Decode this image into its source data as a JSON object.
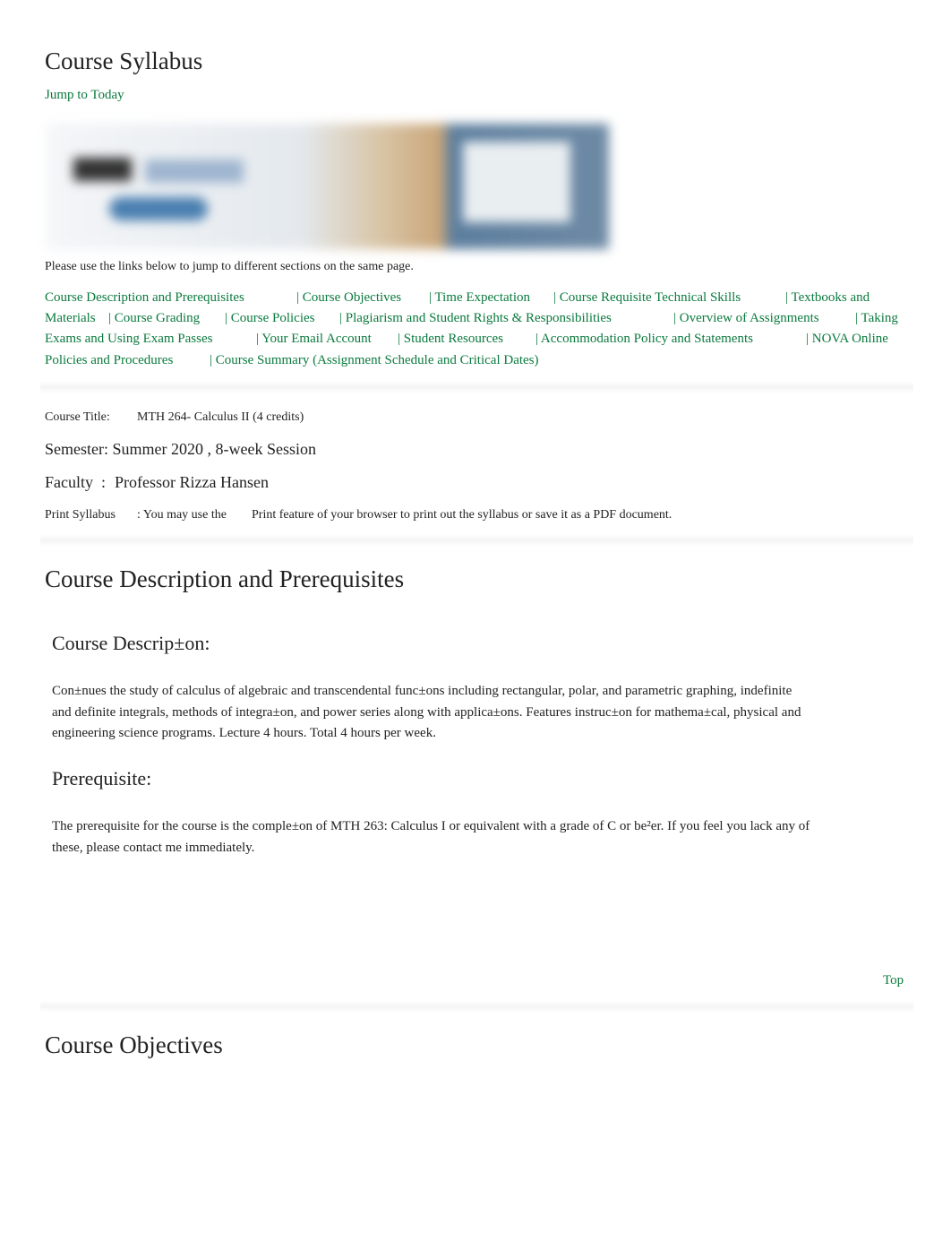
{
  "page_title": "Course Syllabus",
  "jump_to_today": "Jump to Today",
  "banner_alt_text": "NOVA ONLINE",
  "intro": "Please use the links below to jump to different sections on the same page.",
  "nav_links": [
    [
      "Course Description and Prerequisites",
      "| Course Objectives",
      "| Time Expectation",
      "| Course Requisite Technical Skills",
      "| Textbooks and"
    ],
    [
      "Materials",
      "| Course Grading",
      "| Course Policies",
      "| Plagiarism and Student Rights & Responsibilities",
      "| Overview of Assignments",
      "| Taking"
    ],
    [
      "Exams and Using Exam Passes",
      "| Your Email Account",
      "| Student Resources",
      "| Accommodation Policy and Statements",
      "| NOVA Online"
    ],
    [
      "Policies and Procedures",
      "| Course Summary (Assignment Schedule and Critical Dates)"
    ]
  ],
  "course_info": {
    "title_label": "Course Title:",
    "title_value": "MTH 264- Calculus II (4 credits)",
    "semester": "Semester: Summer 2020 , 8-week Session",
    "faculty_label": "Faculty",
    "faculty_sep": ":",
    "faculty_value": "Professor Rizza Hansen",
    "print_label": "Print Syllabus",
    "print_text_1": ": You may use the",
    "print_text_2": "Print feature of your browser to print out the syllabus or save it as a PDF document."
  },
  "section1": {
    "heading": "Course Description and Prerequisites",
    "desc_heading": "Course Descrip±on:",
    "desc_lines": [
      "Con±nues the study of calculus of algebraic and transcendental func±ons including rectangular, polar, and parametric graphing, indefinite",
      "and definite integrals, methods of integra±on, and power series along with applica±ons. Features instruc±on for mathema±cal, physical and",
      "engineering science programs. Lecture 4 hours. Total 4 hours per week."
    ],
    "prereq_heading": "Prerequisite:",
    "prereq_lines": [
      "The prerequisite for the course is the comple±on of MTH 263: Calculus I or equivalent with a grade of C or be²er. If you feel you lack any of",
      "these, please contact me immediately."
    ],
    "top_link": "Top"
  },
  "section2": {
    "heading": "Course Objectives"
  },
  "colors": {
    "link": "#0b7a3e",
    "text": "#222222"
  }
}
